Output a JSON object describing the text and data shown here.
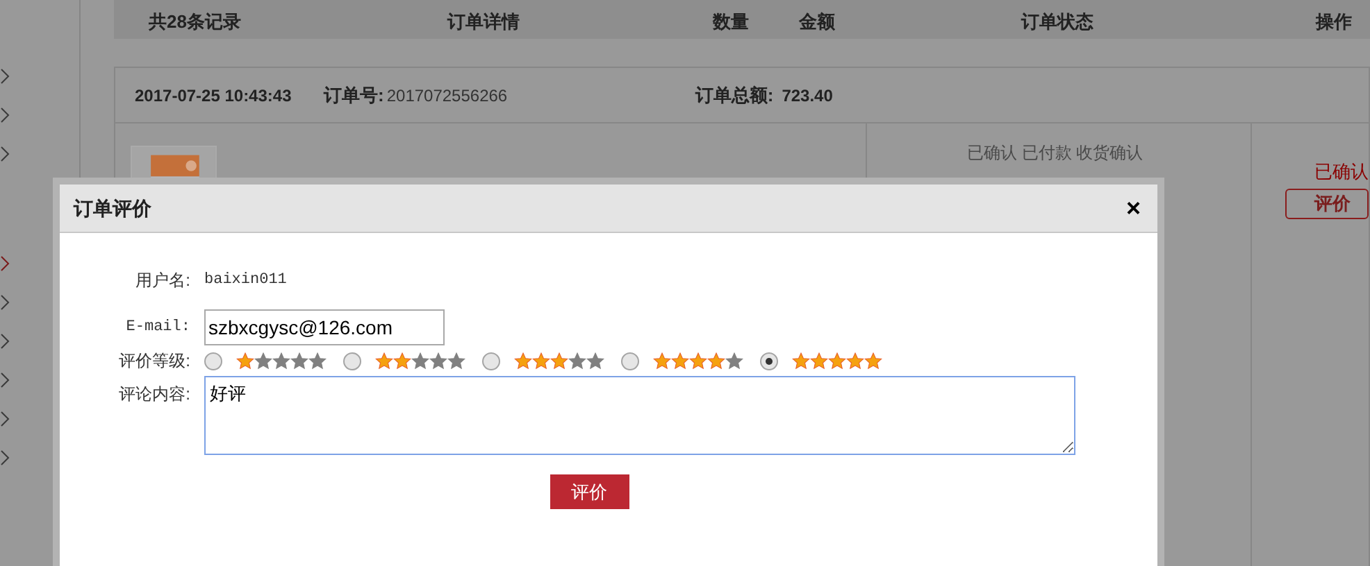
{
  "sidebar": {
    "items": [
      {
        "highlighted": false
      },
      {
        "highlighted": false
      },
      {
        "highlighted": false
      },
      {
        "highlighted": true
      },
      {
        "highlighted": false
      },
      {
        "highlighted": false
      },
      {
        "highlighted": false
      },
      {
        "highlighted": false
      },
      {
        "highlighted": false
      }
    ]
  },
  "table": {
    "columns": [
      "共28条记录",
      "订单详情",
      "数量",
      "金额",
      "订单状态",
      "操作"
    ]
  },
  "order": {
    "date": "2017-07-25 10:43:43",
    "number_label": "订单号:",
    "number": "2017072556266",
    "total_label": "订单总额:",
    "total": "723.40",
    "status": "已确认 已付款 收货确认",
    "state": "已确认",
    "action": "评价"
  },
  "dialog": {
    "title": "订单评价",
    "close": "×",
    "username_label": "用户名:",
    "username": "baixin011",
    "email_label": "E-mail:",
    "email": "szbxcgysc@126.com",
    "rating_label": "评价等级:",
    "rating_options": [
      {
        "stars": 1,
        "selected": false
      },
      {
        "stars": 2,
        "selected": false
      },
      {
        "stars": 3,
        "selected": false
      },
      {
        "stars": 4,
        "selected": false
      },
      {
        "stars": 5,
        "selected": true
      }
    ],
    "comment_label": "评论内容:",
    "comment": "好评",
    "submit": "评价"
  }
}
